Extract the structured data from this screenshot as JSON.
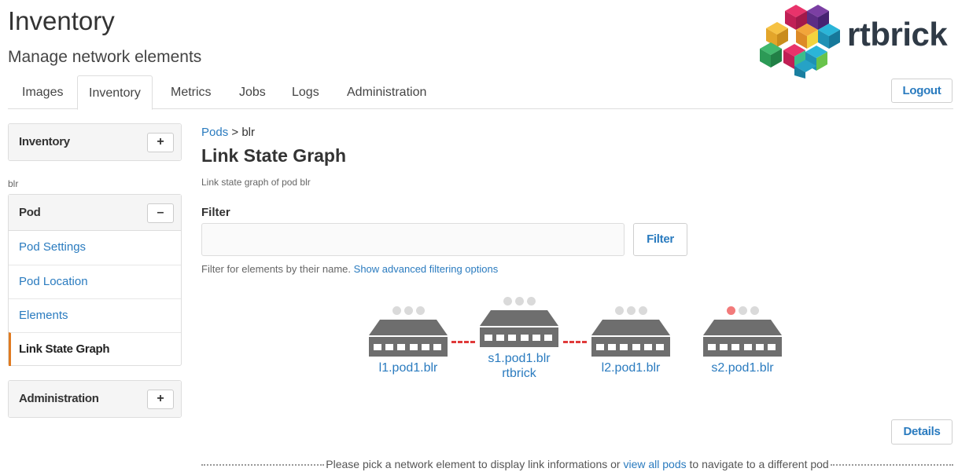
{
  "header": {
    "title": "Inventory",
    "subtitle": "Manage network elements",
    "logo_text": "rtbrick",
    "logout_label": "Logout"
  },
  "tabs": [
    {
      "label": "Images",
      "active": false
    },
    {
      "label": "Inventory",
      "active": true
    },
    {
      "label": "Metrics",
      "active": false
    },
    {
      "label": "Jobs",
      "active": false
    },
    {
      "label": "Logs",
      "active": false
    },
    {
      "label": "Administration",
      "active": false
    }
  ],
  "sidebar": {
    "inventory_panel": {
      "title": "Inventory",
      "toggle": "+"
    },
    "section_label": "blr",
    "pod_panel": {
      "title": "Pod",
      "toggle": "–",
      "items": [
        {
          "label": "Pod Settings",
          "active": false
        },
        {
          "label": "Pod Location",
          "active": false
        },
        {
          "label": "Elements",
          "active": false
        },
        {
          "label": "Link State Graph",
          "active": true
        }
      ]
    },
    "admin_panel": {
      "title": "Administration",
      "toggle": "+"
    }
  },
  "main": {
    "breadcrumb": {
      "parent": "Pods",
      "separator": ">",
      "current": "blr"
    },
    "title": "Link State Graph",
    "description": "Link state graph of pod blr",
    "filter": {
      "label": "Filter",
      "value": "",
      "placeholder": "",
      "button_label": "Filter",
      "help_text": "Filter for elements by their name.",
      "advanced_link": "Show advanced filtering options"
    },
    "graph": {
      "elements": [
        {
          "name": "l1.pod1.blr",
          "sublabel": "",
          "status": [
            "off",
            "off",
            "off"
          ]
        },
        {
          "name": "s1.pod1.blr",
          "sublabel": "rtbrick",
          "status": [
            "off",
            "off",
            "off"
          ]
        },
        {
          "name": "l2.pod1.blr",
          "sublabel": "",
          "status": [
            "off",
            "off",
            "off"
          ]
        },
        {
          "name": "s2.pod1.blr",
          "sublabel": "",
          "status": [
            "alert",
            "off",
            "off"
          ]
        }
      ],
      "link_color": "#e03a3a",
      "alert_color": "#f27a7a"
    },
    "details_label": "Details",
    "bottom_message": {
      "before": "Please pick a network element to display link informations or ",
      "link": "view all pods",
      "after": " to navigate to a different pod"
    }
  },
  "colors": {
    "accent": "#2a7bbf",
    "active_indicator": "#e07b21",
    "device": "#6e6e6e"
  }
}
